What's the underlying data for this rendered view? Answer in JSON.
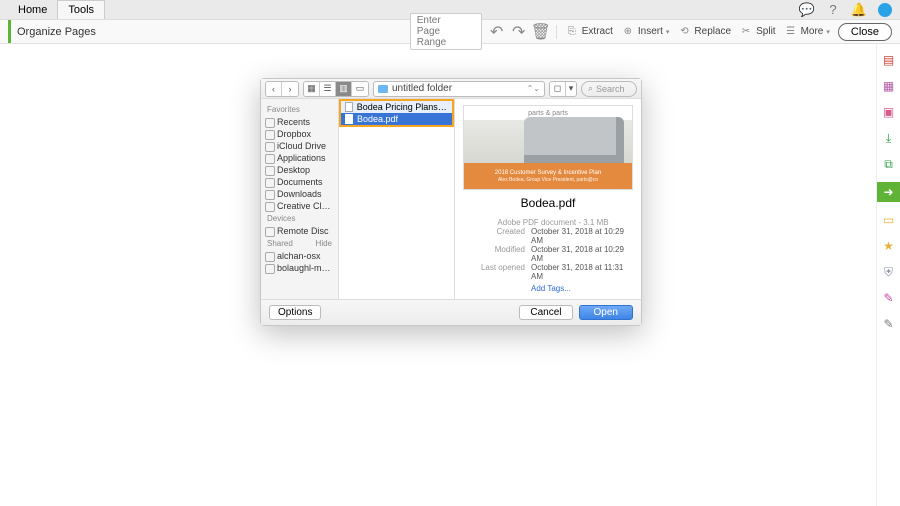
{
  "topbar": {
    "tabs": [
      "Home",
      "Tools"
    ],
    "active_tab": 1
  },
  "subbar": {
    "title": "Organize Pages",
    "page_range_placeholder": "Enter Page Range",
    "extract": "Extract",
    "insert": "Insert",
    "replace": "Replace",
    "split": "Split",
    "more": "More",
    "close": "Close"
  },
  "rail_icons": [
    "pdf-icon",
    "organize-icon",
    "stamp-icon",
    "export-icon",
    "combine-icon",
    "send-icon",
    "comment-icon",
    "star-icon",
    "shield-icon",
    "sign-icon",
    "redact-icon"
  ],
  "dialog": {
    "path_label": "untitled folder",
    "search_placeholder": "Search",
    "sidebar": {
      "favorites_label": "Favorites",
      "favorites": [
        "Recents",
        "Dropbox",
        "iCloud Drive",
        "Applications",
        "Desktop",
        "Documents",
        "Downloads",
        "Creative Cloud..."
      ],
      "devices_label": "Devices",
      "devices": [
        "Remote Disc"
      ],
      "shared_label": "Shared",
      "shared_hide": "Hide",
      "shared": [
        "alchan-osx",
        "bolaughl-mac..."
      ]
    },
    "files": [
      {
        "name": "Bodea Pricing Plans.pdf",
        "selected": false,
        "highlight": true
      },
      {
        "name": "Bodea.pdf",
        "selected": true
      }
    ],
    "preview": {
      "thumb_band_title": "2018 Customer Survey & Incentive Plan",
      "thumb_band_sub": "Alex Bodea, Group Vice President, parts@co",
      "logo_text": "parts & parts",
      "title": "Bodea.pdf",
      "kind": "Adobe PDF document - 3.1 MB",
      "created_k": "Created",
      "created_v": "October 31, 2018 at 10:29 AM",
      "modified_k": "Modified",
      "modified_v": "October 31, 2018 at 10:29 AM",
      "opened_k": "Last opened",
      "opened_v": "October 31, 2018 at 11:31 AM",
      "tags": "Add Tags..."
    },
    "options": "Options",
    "cancel": "Cancel",
    "open": "Open"
  }
}
